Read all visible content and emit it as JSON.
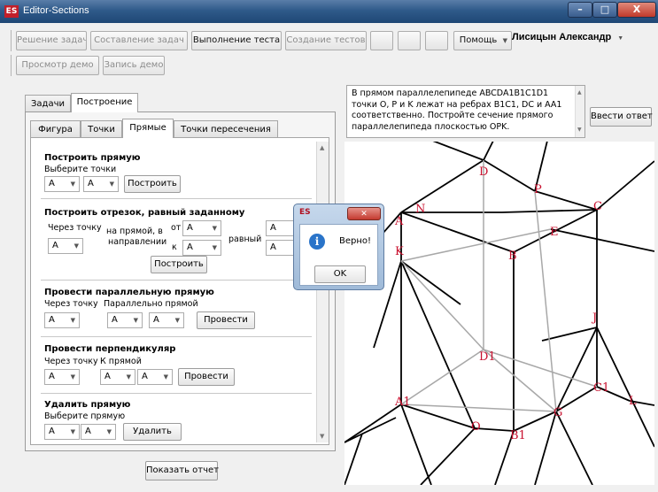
{
  "window": {
    "title": "Editor-Sections",
    "icon_text": "ES"
  },
  "window_controls": {
    "minimize": "–",
    "maximize": "□",
    "close": "X"
  },
  "toolbar": {
    "row1": [
      "Решение задач",
      "Составление задач",
      "Выполнение теста",
      "Создание тестов"
    ],
    "help": "Помощь",
    "user": "Лисицын Александр",
    "row2": [
      "Просмотр демо",
      "Запись демо"
    ]
  },
  "outer_tabs": [
    "Задачи",
    "Построение"
  ],
  "inner_tabs": [
    "Фигура",
    "Точки",
    "Прямые",
    "Точки пересечения"
  ],
  "sec_line": {
    "title": "Построить прямую",
    "subtitle": "Выберите точки",
    "c1": "A",
    "c2": "A",
    "button": "Построить"
  },
  "sec_segment": {
    "title": "Построить отрезок, равный заданному",
    "through_point": "Через точку",
    "c_point": "A",
    "on_line": "на прямой, в",
    "direction": "направлении",
    "from": "от",
    "to": "к",
    "c_from": "A",
    "c_to": "A",
    "equal": "равный",
    "c_eq1": "A",
    "c_eq2": "A",
    "button": "Построить"
  },
  "sec_parallel": {
    "title": "Провести параллельную прямую",
    "through_point": "Через точку",
    "parallel": "Параллельно прямой",
    "c1": "A",
    "c2": "A",
    "c3": "A",
    "button": "Провести"
  },
  "sec_perp": {
    "title": "Провести перпендикуляр",
    "through_point": "Через точку",
    "to_line": "К прямой",
    "c1": "A",
    "c2": "A",
    "c3": "A",
    "button": "Провести"
  },
  "sec_delete": {
    "title": "Удалить прямую",
    "subtitle": "Выберите прямую",
    "c1": "A",
    "c2": "A",
    "button": "Удалить"
  },
  "report_button": "Показать отчет",
  "task_text": "В прямом параллелепипеде ABCDA1B1C1D1 точки O, P и K лежат на ребрах B1C1, DC и AA1 соответственно. Постройте сечение прямого параллелепипеда плоскостью OPK.",
  "answer_button": "Ввести ответ",
  "dialog": {
    "icon_text": "ES",
    "message": "Верно!",
    "ok": "OK",
    "info_symbol": "i"
  },
  "figure_labels": {
    "D": "D",
    "P": "P",
    "C": "C",
    "A": "A",
    "N": "N",
    "E": "E",
    "K": "K",
    "B": "B",
    "J": "J",
    "D1": "D1",
    "C1": "C1",
    "A1": "A1",
    "L": "L",
    "O": "O",
    "B1": "B1",
    "G": "G"
  },
  "colors": {
    "vertex_label": "#c8102e",
    "edge": "#000000",
    "hidden_edge": "#a8a8a8"
  }
}
